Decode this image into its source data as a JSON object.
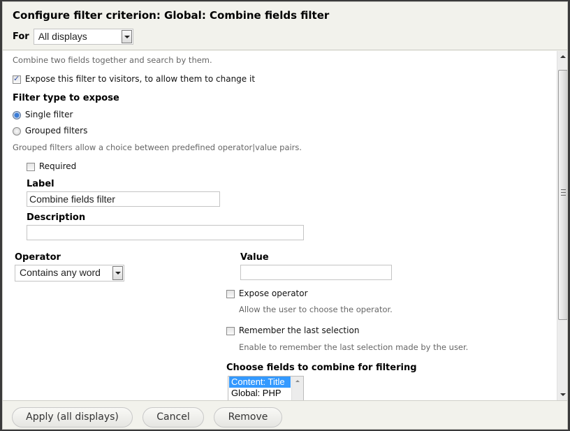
{
  "dialog": {
    "title": "Configure filter criterion: Global: Combine fields filter",
    "for_label": "For",
    "for_select_value": "All displays"
  },
  "form": {
    "intro": "Combine two fields together and search by them.",
    "expose_checkbox": {
      "label": "Expose this filter to visitors, to allow them to change it",
      "checked": true
    },
    "filter_type_heading": "Filter type to expose",
    "filter_type_options": [
      {
        "label": "Single filter",
        "checked": true
      },
      {
        "label": "Grouped filters",
        "checked": false
      }
    ],
    "grouped_help": "Grouped filters allow a choice between predefined operator|value pairs.",
    "required": {
      "label": "Required",
      "checked": false
    },
    "label_field": {
      "label": "Label",
      "value": "Combine fields filter"
    },
    "description_field": {
      "label": "Description",
      "value": ""
    },
    "operator": {
      "label": "Operator",
      "value": "Contains any word"
    },
    "value_field": {
      "label": "Value",
      "value": ""
    },
    "expose_operator": {
      "label": "Expose operator",
      "checked": false,
      "help": "Allow the user to choose the operator."
    },
    "remember_selection": {
      "label": "Remember the last selection",
      "checked": false,
      "help": "Enable to remember the last selection made by the user."
    },
    "fields_to_combine": {
      "label": "Choose fields to combine for filtering",
      "options": [
        {
          "label": "Content: Title",
          "selected": true
        },
        {
          "label": "Global: PHP",
          "selected": false
        }
      ]
    }
  },
  "footer": {
    "apply_label": "Apply (all displays)",
    "cancel_label": "Cancel",
    "remove_label": "Remove"
  },
  "colors": {
    "selection": "#3399ff",
    "panel_background": "#f2f2ec"
  }
}
